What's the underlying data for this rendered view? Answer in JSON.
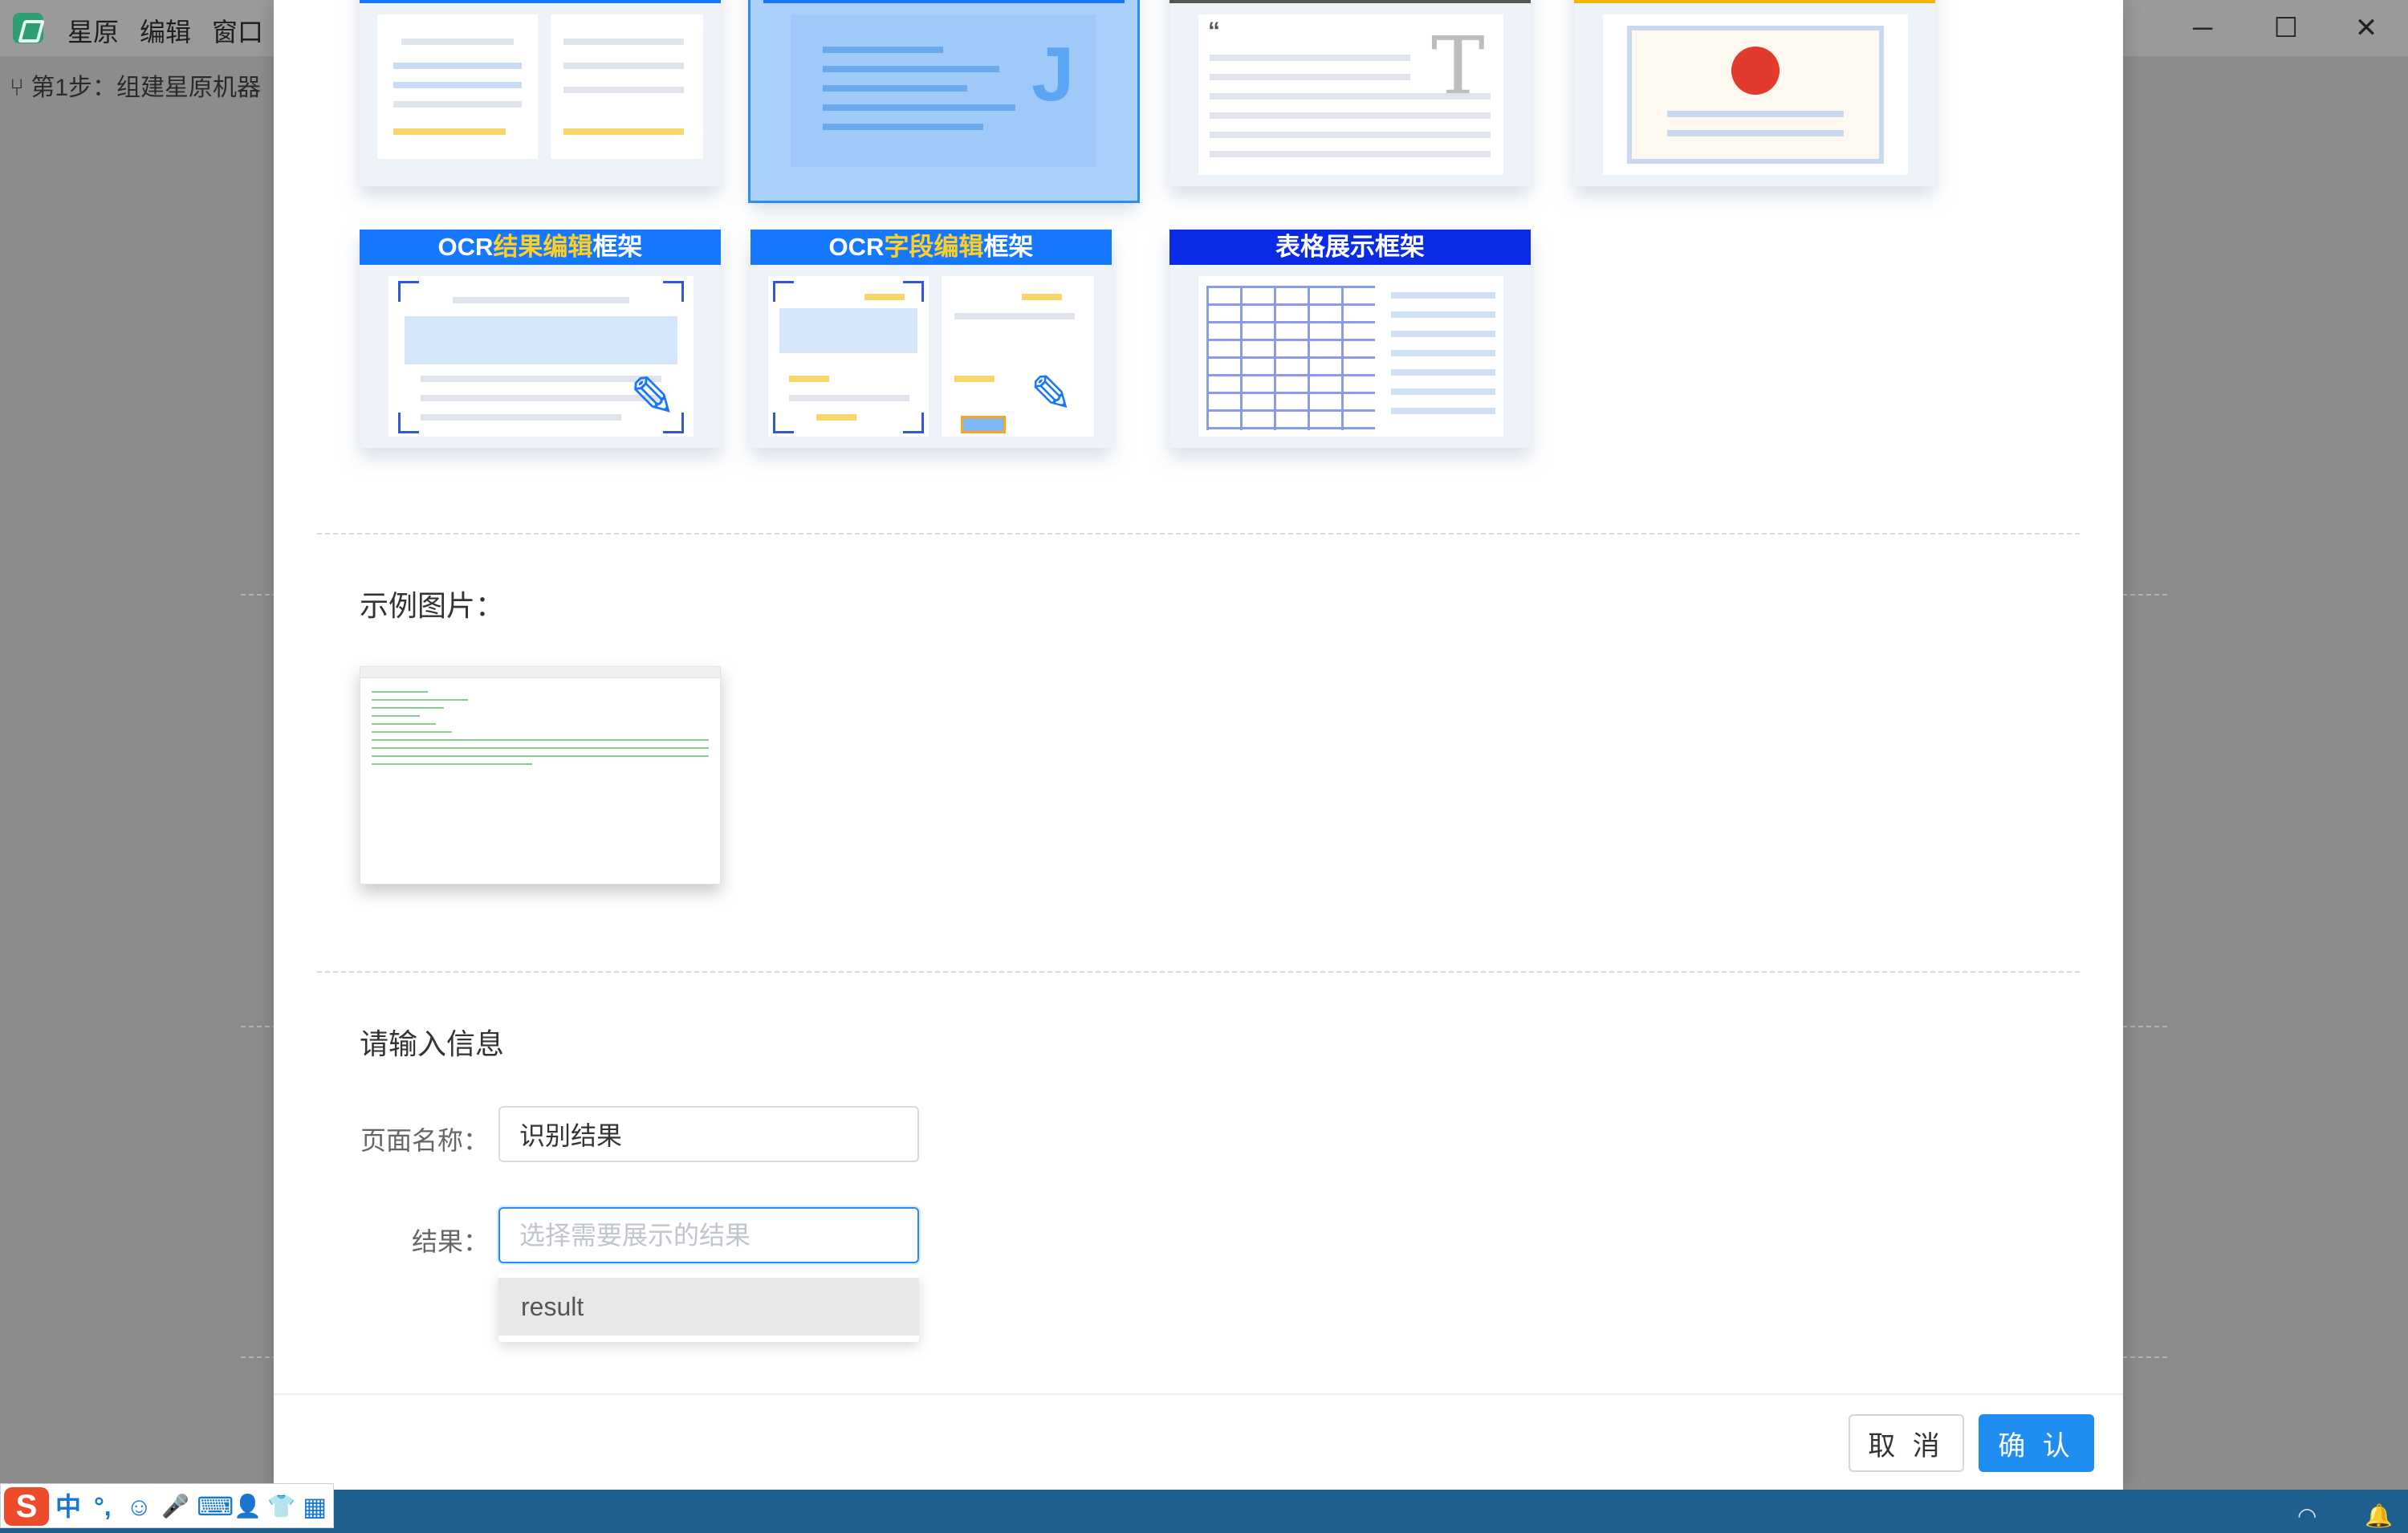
{
  "app": {
    "menu": [
      "星原",
      "编辑",
      "窗口"
    ],
    "breadcrumb": "第1步：组建星原机器"
  },
  "window_controls": {
    "minimize": "─",
    "maximize": "☐",
    "close": "✕"
  },
  "templates": [
    {
      "title_parts": [
        "",
        "",
        ""
      ],
      "color": "#1677ff",
      "selected": false
    },
    {
      "title_parts": [
        "",
        "",
        ""
      ],
      "color": "#1677ff",
      "selected": true
    },
    {
      "title_parts": [
        "",
        "",
        ""
      ],
      "color": "#555555",
      "selected": false
    },
    {
      "title_parts": [
        "",
        "",
        ""
      ],
      "color": "#f5b400",
      "selected": false
    },
    {
      "title_parts": [
        "OCR",
        "结果编辑",
        "框架"
      ],
      "color": "#1677ff",
      "selected": false
    },
    {
      "title_parts": [
        "OCR",
        "字段编辑",
        "框架"
      ],
      "color": "#1677ff",
      "selected": false
    },
    {
      "title_parts": [
        "表格展示框架",
        "",
        ""
      ],
      "color": "#0a2be6",
      "selected": false
    }
  ],
  "example": {
    "label": "示例图片："
  },
  "form": {
    "heading": "请输入信息",
    "page_name_label": "页面名称：",
    "page_name_value": "识别结果",
    "result_label": "结果：",
    "result_placeholder": "选择需要展示的结果",
    "result_options": [
      "result"
    ]
  },
  "footer": {
    "cancel": "取 消",
    "confirm": "确 认"
  },
  "ime": {
    "items": [
      "中",
      "°,",
      "☺",
      "🎤",
      "⌨",
      "👤",
      "👕",
      "▦"
    ]
  },
  "colors": {
    "primary": "#1e8ef3",
    "accent": "#ffd024"
  }
}
